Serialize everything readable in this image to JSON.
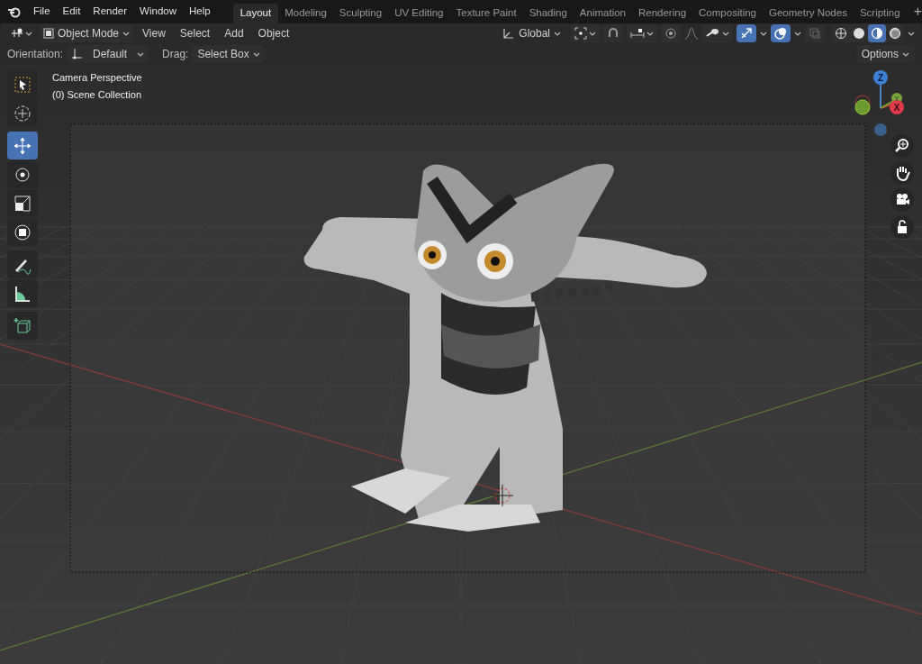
{
  "menu": [
    "File",
    "Edit",
    "Render",
    "Window",
    "Help"
  ],
  "workspace_tabs": [
    {
      "label": "Layout",
      "selected": true
    },
    {
      "label": "Modeling",
      "selected": false
    },
    {
      "label": "Sculpting",
      "selected": false
    },
    {
      "label": "UV Editing",
      "selected": false
    },
    {
      "label": "Texture Paint",
      "selected": false
    },
    {
      "label": "Shading",
      "selected": false
    },
    {
      "label": "Animation",
      "selected": false
    },
    {
      "label": "Rendering",
      "selected": false
    },
    {
      "label": "Compositing",
      "selected": false
    },
    {
      "label": "Geometry Nodes",
      "selected": false
    },
    {
      "label": "Scripting",
      "selected": false
    }
  ],
  "add_tab": "+",
  "header": {
    "mode": "Object Mode",
    "menus": [
      "View",
      "Select",
      "Add",
      "Object"
    ],
    "transform_orientation": "Global",
    "snap_on": false,
    "proportional_on": false,
    "gizmos_on": true,
    "overlays_on": true,
    "xray_on": false,
    "shading_modes": [
      {
        "kind": "wireframe",
        "selected": false
      },
      {
        "kind": "solid",
        "selected": false
      },
      {
        "kind": "material",
        "selected": true
      },
      {
        "kind": "rendered",
        "selected": false
      }
    ]
  },
  "tool_settings": {
    "orientation_label": "Orientation:",
    "orientation": "Default",
    "drag_label": "Drag:",
    "drag": "Select Box",
    "options": "Options"
  },
  "tools": [
    {
      "kind": "select",
      "selected": false
    },
    {
      "kind": "cursor",
      "selected": false
    },
    {
      "kind": "move",
      "selected": true
    },
    {
      "kind": "rotate",
      "selected": false
    },
    {
      "kind": "scale",
      "selected": false
    },
    {
      "kind": "transform",
      "selected": false
    },
    {
      "kind": "annotate",
      "selected": false
    },
    {
      "kind": "measure",
      "selected": false
    },
    {
      "kind": "add-cube",
      "selected": false
    }
  ],
  "viewport": {
    "view_name": "Camera Perspective",
    "collection": "(0) Scene Collection"
  },
  "gizmo": {
    "z": "Z",
    "y": "Y",
    "x": "X"
  },
  "nav_buttons": [
    {
      "kind": "zoom"
    },
    {
      "kind": "pan"
    },
    {
      "kind": "camera"
    },
    {
      "kind": "lock"
    }
  ]
}
